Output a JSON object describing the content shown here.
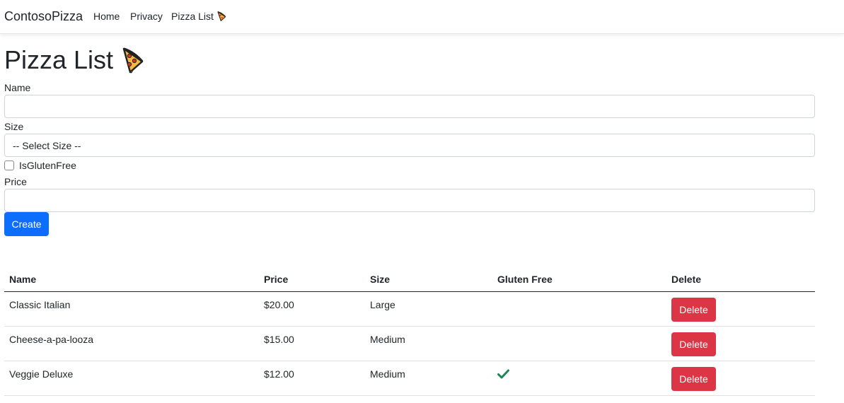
{
  "navbar": {
    "brand": "ContosoPizza",
    "links": [
      "Home",
      "Privacy",
      "Pizza List"
    ]
  },
  "page": {
    "title": "Pizza List"
  },
  "form": {
    "name_label": "Name",
    "name_value": "",
    "size_label": "Size",
    "size_selected": "-- Select Size --",
    "gluten_label": "IsGlutenFree",
    "gluten_checked": false,
    "price_label": "Price",
    "price_value": "",
    "create_label": "Create"
  },
  "table": {
    "headers": [
      "Name",
      "Price",
      "Size",
      "Gluten Free",
      "Delete"
    ],
    "rows": [
      {
        "name": "Classic Italian",
        "price": "$20.00",
        "size": "Large",
        "gluten_free": false,
        "delete_label": "Delete"
      },
      {
        "name": "Cheese-a-pa-looza",
        "price": "$15.00",
        "size": "Medium",
        "gluten_free": false,
        "delete_label": "Delete"
      },
      {
        "name": "Veggie Deluxe",
        "price": "$12.00",
        "size": "Medium",
        "gluten_free": true,
        "delete_label": "Delete"
      }
    ]
  },
  "colors": {
    "primary": "#0d6efd",
    "danger": "#dc3545",
    "check": "#198754"
  },
  "icons": {
    "pizza": "pizza-icon",
    "check": "check-icon"
  }
}
